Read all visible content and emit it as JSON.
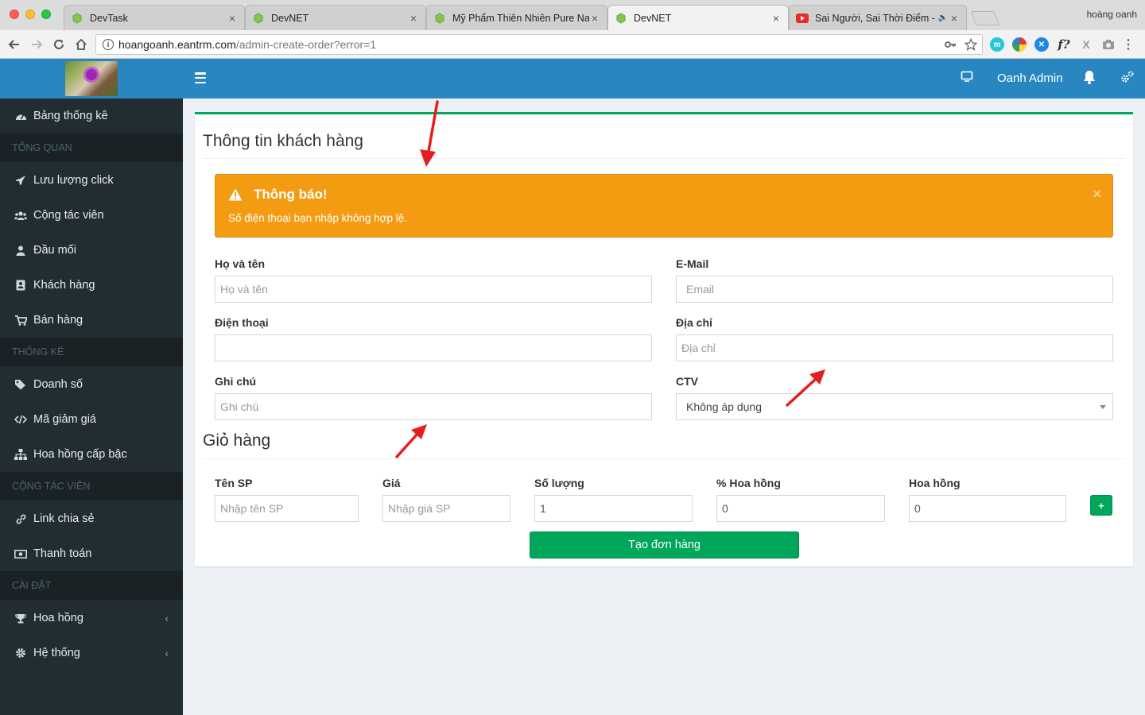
{
  "browser": {
    "tabs": [
      {
        "title": "DevTask",
        "close": "×"
      },
      {
        "title": "DevNET",
        "close": "×"
      },
      {
        "title": "Mỹ Phẩm Thiên Nhiên Pure Na",
        "close": "×"
      },
      {
        "title": "DevNET",
        "close": "×"
      },
      {
        "title": "Sai Người, Sai Thời Điểm - ",
        "close": "×"
      }
    ],
    "profile_name": "hoàng oanh",
    "url_host": "hoangoanh.eantrm.com",
    "url_path": "/admin-create-order?error=1"
  },
  "header": {
    "user_name": "Oanh Admin"
  },
  "sidebar": {
    "items": [
      {
        "label": "Bảng thống kê",
        "icon": "dashboard-icon"
      },
      {
        "header": "TỔNG QUAN"
      },
      {
        "label": "Lưu lượng click",
        "icon": "rocket-icon"
      },
      {
        "label": "Cộng tác viên",
        "icon": "users-icon"
      },
      {
        "label": "Đầu mối",
        "icon": "user-icon"
      },
      {
        "label": "Khách hàng",
        "icon": "address-book-icon"
      },
      {
        "label": "Bán hàng",
        "icon": "cart-icon"
      },
      {
        "header": "THỐNG KÊ"
      },
      {
        "label": "Doanh số",
        "icon": "tags-icon"
      },
      {
        "label": "Mã giảm giá",
        "icon": "code-icon"
      },
      {
        "label": "Hoa hồng cấp bậc",
        "icon": "sitemap-icon"
      },
      {
        "header": "CỘNG TÁC VIÊN"
      },
      {
        "label": "Link chia sẻ",
        "icon": "link-icon"
      },
      {
        "label": "Thanh toán",
        "icon": "money-icon"
      },
      {
        "header": "CÀI ĐẶT"
      },
      {
        "label": "Hoa hồng",
        "icon": "trophy-icon",
        "chevron": "‹"
      },
      {
        "label": "Hệ thống",
        "icon": "cog-icon",
        "chevron": "‹"
      }
    ]
  },
  "form": {
    "title": "Thông tin khách hàng",
    "alert": {
      "title": "Thông báo!",
      "message": "Số điện thoại bạn nhập không hợp lệ.",
      "close": "×"
    },
    "fields": {
      "name": {
        "label": "Họ và tên",
        "placeholder": "Họ và tên",
        "value": ""
      },
      "email": {
        "label": "E-Mail",
        "placeholder": "Email",
        "value": ""
      },
      "phone": {
        "label": "Điện thoại",
        "placeholder": "",
        "value": ""
      },
      "address": {
        "label": "Địa chỉ",
        "placeholder": "Địa chỉ",
        "value": ""
      },
      "note": {
        "label": "Ghi chú",
        "placeholder": "Ghi chú",
        "value": ""
      },
      "ctv": {
        "label": "CTV",
        "selected": "Không áp dụng"
      }
    }
  },
  "cart": {
    "title": "Giỏ hàng",
    "columns": {
      "product": {
        "label": "Tên SP",
        "placeholder": "Nhập tên SP",
        "value": ""
      },
      "price": {
        "label": "Giá",
        "placeholder": "Nhập giá SP",
        "value": ""
      },
      "quantity": {
        "label": "Số lượng",
        "value": "1"
      },
      "commission_percent": {
        "label": "% Hoa hồng",
        "value": "0"
      },
      "commission": {
        "label": "Hoa hồng",
        "value": "0"
      }
    },
    "add_label": "+",
    "submit_label": "Tạo đơn hàng"
  },
  "colors": {
    "header": "#2887c0",
    "sidebar": "#222d32",
    "alert": "#f39c12",
    "success": "#00a65a",
    "annotation_arrow": "#e41e1e"
  }
}
